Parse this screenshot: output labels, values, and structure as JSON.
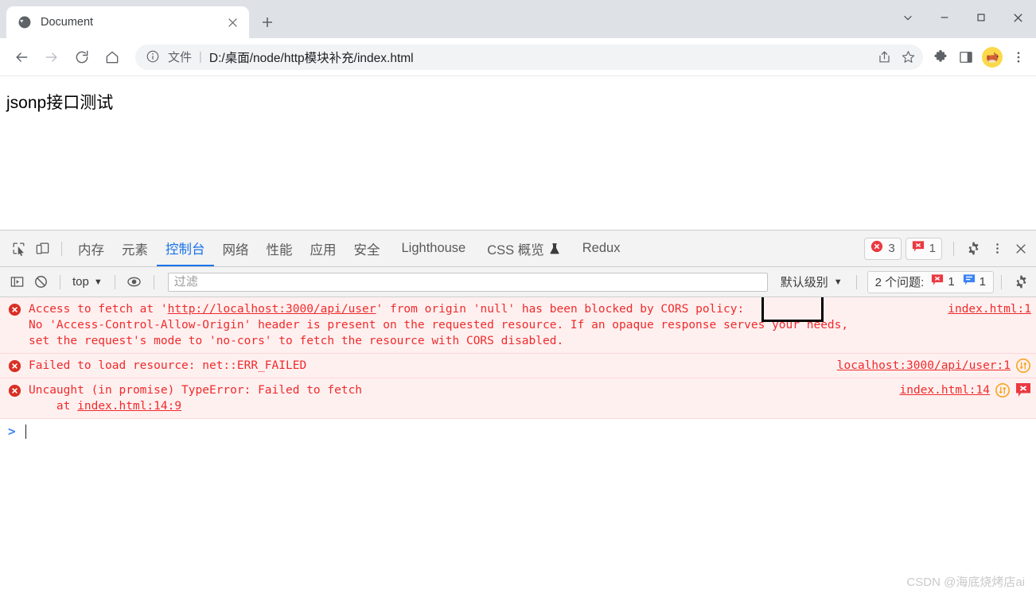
{
  "window": {
    "controls": {
      "chevron_label": "chevron-down",
      "minimize_label": "minimize",
      "maximize_label": "maximize",
      "close_label": "close"
    }
  },
  "tabs": [
    {
      "title": "Document",
      "favicon": "globe-icon",
      "close_label": "×"
    }
  ],
  "newtab": {
    "label": "+"
  },
  "toolbar": {
    "back_label": "back",
    "forward_label": "forward",
    "reload_label": "reload",
    "home_label": "home",
    "omnibox": {
      "info_icon": "info-circle-icon",
      "scheme_text": "文件",
      "separator": "|",
      "url": "D:/桌面/node/http模块补充/index.html",
      "share_icon": "share-icon",
      "bookmark_icon": "star-icon"
    },
    "extensions_icon": "puzzle-icon",
    "sidepanel_icon": "side-panel-icon",
    "avatar_icon": "dog-avatar",
    "menu_icon": "kebab-menu-icon"
  },
  "page": {
    "heading": "jsonp接口测试"
  },
  "devtools": {
    "left_icons": [
      {
        "name": "inspect-element-icon"
      },
      {
        "name": "device-toolbar-icon"
      }
    ],
    "tabs": [
      {
        "label": "内存",
        "active": false
      },
      {
        "label": "元素",
        "active": false
      },
      {
        "label": "控制台",
        "active": true
      },
      {
        "label": "网络",
        "active": false
      },
      {
        "label": "性能",
        "active": false
      },
      {
        "label": "应用",
        "active": false
      },
      {
        "label": "安全",
        "active": false
      },
      {
        "label": "Lighthouse",
        "active": false
      },
      {
        "label": "CSS 概览",
        "active": false,
        "icon": "flask-icon"
      },
      {
        "label": "Redux",
        "active": false
      }
    ],
    "badges": {
      "errors_count": "3",
      "issues_count": "1"
    },
    "settings_icon": "gear-icon",
    "more_icon": "kebab-menu-icon",
    "close_icon": "close-icon",
    "filterbar": {
      "sidebar_icon": "console-sidebar-icon",
      "clear_icon": "clear-console-icon",
      "context": "top",
      "context_caret": "▼",
      "eye_icon": "live-expression-icon",
      "filter_placeholder": "过滤",
      "filter_value": "",
      "level": "默认级别",
      "level_caret": "▼",
      "issues_label": "2 个问题:",
      "issues_error_count": "1",
      "issues_info_count": "1",
      "settings_icon": "gear-icon"
    },
    "messages": [
      {
        "level": "error",
        "icon": "error-circle-icon",
        "segments": [
          {
            "text": "Access to fetch at '",
            "link": false
          },
          {
            "text": "http://localhost:3000/api/user",
            "link": true
          },
          {
            "text": "' from origin 'null' has been blocked by CORS policy:\nNo 'Access-Control-Allow-Origin' header is present on the requested resource. If an opaque response serves your needs,\nset the request's mode to 'no-cors' to fetch the resource with CORS disabled.",
            "link": false
          }
        ],
        "source": "index.html:1",
        "badges": []
      },
      {
        "level": "error",
        "icon": "error-circle-icon",
        "segments": [
          {
            "text": "Failed to load resource: net::ERR_FAILED",
            "link": false
          }
        ],
        "source": "localhost:3000/api/user:1",
        "badges": [
          "network-issue-icon"
        ]
      },
      {
        "level": "error",
        "icon": "error-circle-icon",
        "segments": [
          {
            "text": "Uncaught (in promise) TypeError: Failed to fetch\n    at ",
            "link": false
          },
          {
            "text": "index.html:14:9",
            "link": true
          }
        ],
        "source": "index.html:14",
        "badges": [
          "network-issue-icon",
          "issue-bubble-icon"
        ]
      }
    ],
    "prompt": {
      "caret": ">",
      "value": ""
    }
  },
  "annotation": {
    "target_word": "CORS",
    "color": "#000000"
  },
  "watermark": {
    "text": "CSDN @海底烧烤店ai"
  }
}
